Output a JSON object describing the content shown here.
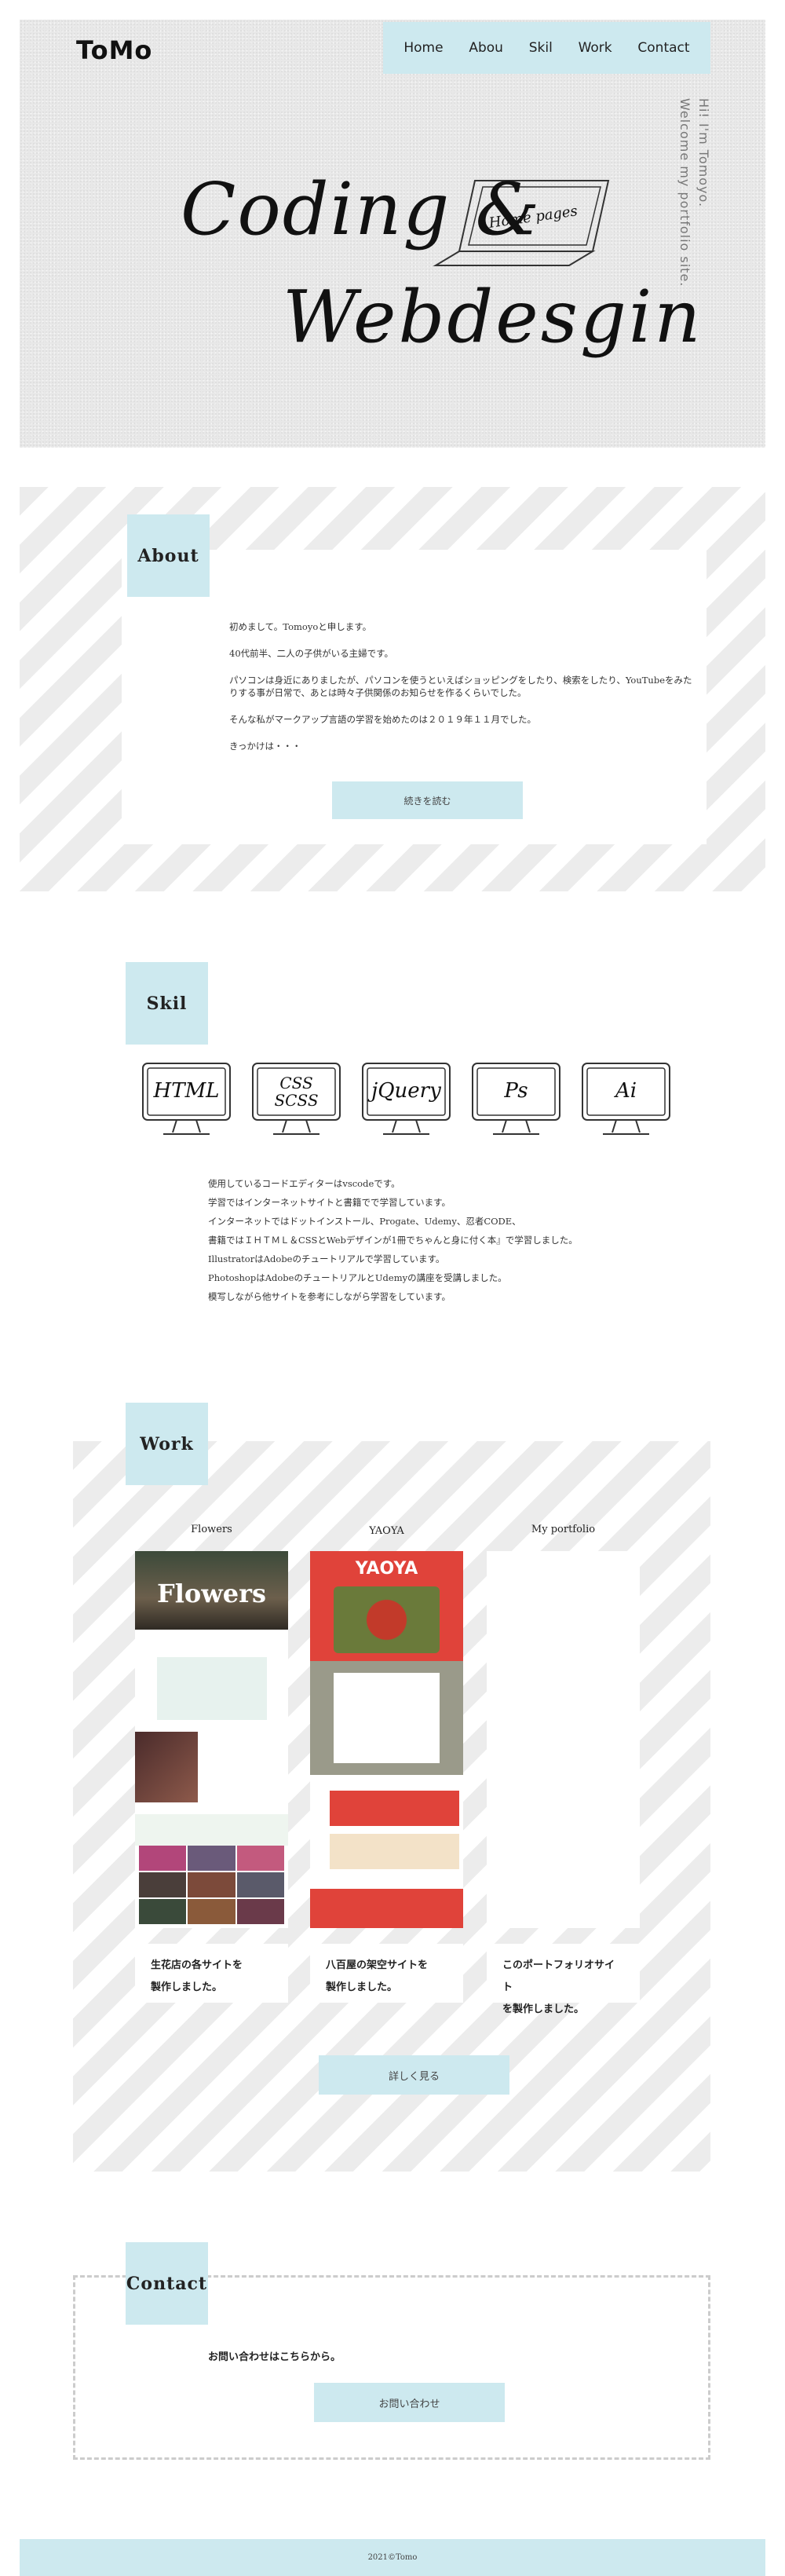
{
  "header": {
    "logo_main": "ToMo",
    "nav": [
      "Home",
      "Abou",
      "Skil",
      "Work",
      "Contact"
    ],
    "vertical_line1": "Hi! I'm Tomoyo.",
    "vertical_line2": "Welcome my portfolio site.",
    "title_line1": "Coding &",
    "title_line2": "Webdesgin",
    "laptop_screen": "Home pages"
  },
  "about": {
    "tab": "About",
    "paragraphs": [
      "初めまして。Tomoyoと申します。",
      "40代前半、二人の子供がいる主婦です。",
      "パソコンは身近にありましたが、パソコンを使うといえばショッピングをしたり、検索をしたり、YouTubeをみたりする事が日常で、あとは時々子供関係のお知らせを作るくらいでした。",
      "そんな私がマークアップ言語の学習を始めたのは２０１９年１１月でした。",
      "きっかけは・・・"
    ],
    "button": "続きを読む"
  },
  "skill": {
    "tab": "Skil",
    "monitors": [
      {
        "label": "HTML",
        "icon": "html-monitor-icon"
      },
      {
        "label": "CSS\nSCSS",
        "icon": "css-monitor-icon"
      },
      {
        "label": "jQuery",
        "icon": "jquery-monitor-icon"
      },
      {
        "label": "Ps",
        "icon": "photoshop-monitor-icon"
      },
      {
        "label": "Ai",
        "icon": "illustrator-monitor-icon"
      }
    ],
    "lines": [
      "使用しているコードエディターはvscodeです。",
      "学習ではインターネットサイトと書籍でで学習しています。",
      "インターネットではドットインストール、Progate、Udemy、忍者CODE、",
      "書籍ではＩＨＴＭＬ＆CSSとWebデザインが1冊でちゃんと身に付く本』で学習しました。",
      "IllustratorはAdobeのチュートリアルで学習しています。",
      "PhotoshopはAdobeのチュートリアルとUdemyの講座を受講しました。",
      "模写しながら他サイトを参考にしながら学習をしています。"
    ]
  },
  "work": {
    "tab": "Work",
    "items": [
      {
        "title": "Flowers",
        "banner": "Flowers",
        "desc_line1": "生花店の各サイトを",
        "desc_line2": "製作しました。"
      },
      {
        "title": "YAOYA",
        "banner": "YAOYA",
        "desc_line1": "八百屋の架空サイトを",
        "desc_line2": "製作しました。"
      },
      {
        "title": "My portfolio",
        "banner": "",
        "desc_line1": "このポートフォリオサイト",
        "desc_line2": "を製作しました。"
      }
    ],
    "button": "詳しく見る"
  },
  "contact": {
    "tab": "Contact",
    "text": "お問い合わせはこちらから。",
    "button": "お問い合わせ"
  },
  "footer": {
    "text": "2021©Tomo"
  },
  "colors": {
    "accent": "#cde9ef",
    "stripe": "#ececec",
    "hero_bg": "#e8e8e8"
  }
}
